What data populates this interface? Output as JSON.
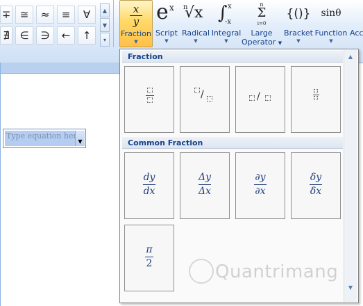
{
  "ribbon": {
    "symbols_row1": [
      "∓",
      "≅",
      "≈",
      "≡",
      "∀"
    ],
    "symbols_row2": [
      "∄",
      "∈",
      "∋",
      "←",
      "↑"
    ],
    "tools": [
      {
        "id": "fraction",
        "label": "Fraction",
        "icon_top": "x",
        "icon_bottom": "y"
      },
      {
        "id": "script",
        "label": "Script",
        "icon": "e",
        "icon_sup": "x"
      },
      {
        "id": "radical",
        "label": "Radical",
        "icon_index": "n",
        "icon": "√x"
      },
      {
        "id": "integral",
        "label": "Integral",
        "icon": "∫",
        "icon_sup": "x",
        "icon_sub": "-x"
      },
      {
        "id": "large-operator",
        "label": "Large",
        "label2": "Operator",
        "icon_top": "n",
        "icon": "Σ",
        "icon_bottom": "i=0"
      },
      {
        "id": "bracket",
        "label": "Bracket",
        "icon": "{()}"
      },
      {
        "id": "function",
        "label": "Function",
        "icon": "sinθ"
      },
      {
        "id": "accent",
        "label": "Acc"
      }
    ]
  },
  "document": {
    "equation_placeholder": "Type equation here."
  },
  "gallery": {
    "section_fraction": "Fraction",
    "section_common": "Common Fraction",
    "common_fractions": [
      {
        "num": "dy",
        "den": "dx"
      },
      {
        "num": "Δy",
        "den": "Δx"
      },
      {
        "num": "∂y",
        "den": "∂x"
      },
      {
        "num": "δy",
        "den": "δx"
      },
      {
        "num": "π",
        "den": "2"
      }
    ]
  },
  "watermark": {
    "text": "Quantrimang"
  }
}
